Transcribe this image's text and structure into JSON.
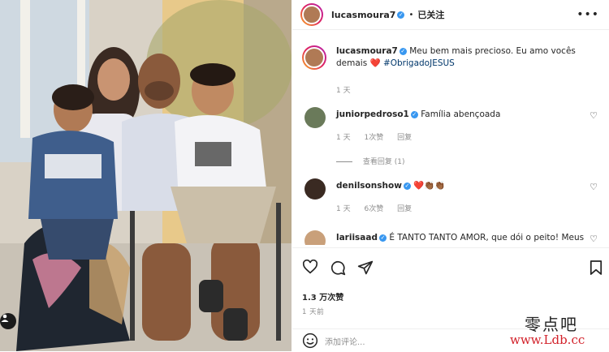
{
  "post": {
    "username": "lucasmoura7",
    "follow_status": "已关注",
    "caption": "Meu bem mais precioso. Eu amo vocês demais",
    "caption_emoji": "❤️",
    "hashtag": "#ObrigadoJESUS",
    "caption_age": "1 天",
    "likes": "1.3 万次赞",
    "posted_ago": "1 天前"
  },
  "comments": [
    {
      "username": "juniorpedroso1",
      "text": "Família abençoada",
      "age": "1 天",
      "likes": "1次赞",
      "reply": "回复",
      "view_replies": "查看回复 (1)"
    },
    {
      "username": "denilsonshow",
      "text": "",
      "emoji": "❤️👏🏾👏🏾",
      "age": "1 天",
      "likes": "6次赞",
      "reply": "回复"
    },
    {
      "username": "lariisaad",
      "text": "É TANTO TANTO AMOR, que dói o peito! Meus"
    }
  ],
  "comment_input": {
    "placeholder": "添加评论..."
  },
  "watermark": {
    "line1": "零点吧",
    "line2": "www.Ldb.cc"
  },
  "colors": {
    "verified": "#3897f0",
    "hashtag": "#00376b",
    "muted": "#8e8e8e",
    "heart": "#e0245e"
  },
  "icons": [
    "more-options-icon",
    "heart-icon",
    "comment-icon",
    "share-icon",
    "bookmark-icon",
    "emoji-icon",
    "user-tag-icon"
  ]
}
